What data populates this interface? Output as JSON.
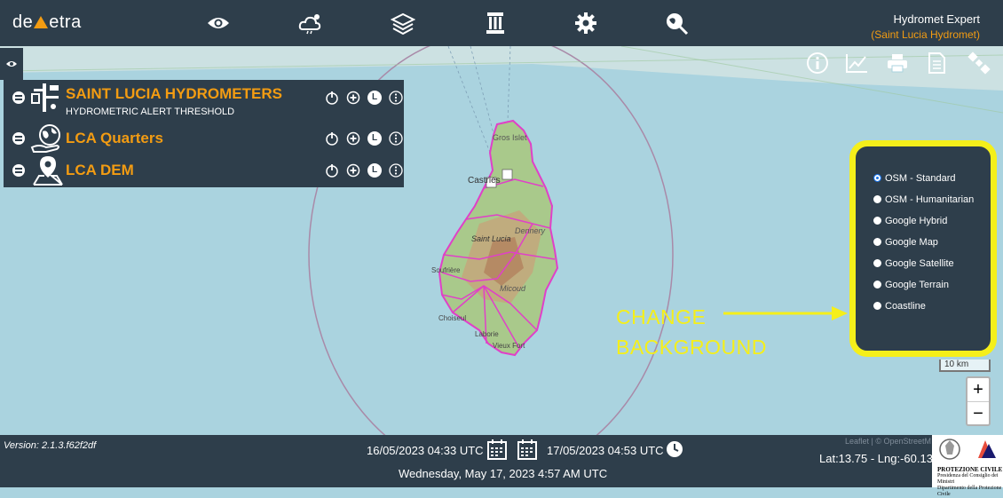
{
  "app": {
    "logo_text_before": "de",
    "logo_text_after": "etra",
    "user_name": "Hydromet Expert",
    "user_org": "(Saint Lucia Hydromet)"
  },
  "nav_icons": [
    "eye-icon",
    "weather-icon",
    "layers-icon",
    "archive-icon",
    "gear-icon",
    "globe-search-icon"
  ],
  "layers": [
    {
      "name": "SAINT LUCIA HYDROMETERS",
      "subtitle": "HYDROMETRIC ALERT THRESHOLD",
      "icon": "hydrometer-icon"
    },
    {
      "name": "LCA Quarters",
      "subtitle": "",
      "icon": "globe-hand-icon"
    },
    {
      "name": "LCA DEM",
      "subtitle": "",
      "icon": "map-pin-icon"
    }
  ],
  "layer_controls": {
    "legend_letter": "L"
  },
  "map": {
    "labels": [
      "Gros Islet",
      "Castries",
      "Dennery",
      "Saint Lucia",
      "Soufrière",
      "Micoud",
      "Choiseul",
      "Laborie",
      "Vieux Fort"
    ]
  },
  "toolbar_icons": [
    "info-icon",
    "chart-icon",
    "print-icon",
    "document-icon",
    "satellite-icon"
  ],
  "background_options": {
    "selected": "OSM - Standard",
    "items": [
      "OSM - Standard",
      "OSM - Humanitarian",
      "Google Hybrid",
      "Google Map",
      "Google Satellite",
      "Google Terrain",
      "Coastline"
    ]
  },
  "annotation": {
    "line1": "CHANGE",
    "line2": "BACKGROUND"
  },
  "scale": "10 km",
  "zoom": {
    "in": "+",
    "out": "−"
  },
  "footer": {
    "version": "Version: 2.1.3.f62f2df",
    "date_from": "16/05/2023 04:33 UTC",
    "date_to": "17/05/2023 04:53 UTC",
    "current": "Wednesday, May 17, 2023 4:57 AM UTC",
    "attribution": "Leaflet | © OpenStreetM",
    "coords": "Lat:13.75 - Lng:-60.13",
    "protezione_title": "PROTEZIONE CIVILE",
    "protezione_sub1": "Presidenza del Consiglio dei Ministri",
    "protezione_sub2": "Dipartimento della Protezione Civile"
  },
  "colors": {
    "bar": "#2e3e4b",
    "accent": "#f39c12",
    "highlight": "#f5ef1a",
    "sea": "#aad3df",
    "boundary": "#e040c8"
  }
}
